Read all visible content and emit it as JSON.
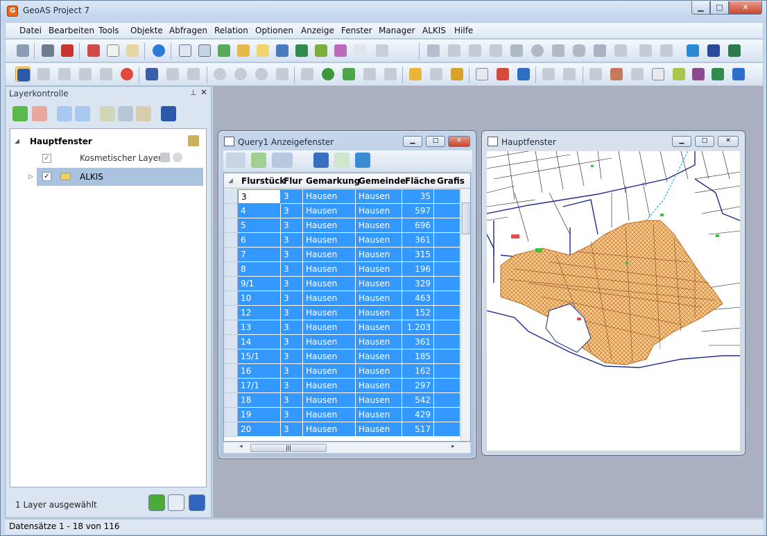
{
  "app": {
    "title": "GeoAS Project 7"
  },
  "menu": [
    "Datei",
    "Bearbeiten",
    "Tools",
    "Objekte",
    "Abfragen",
    "Relation",
    "Optionen",
    "Anzeige",
    "Fenster",
    "Manager",
    "ALKIS",
    "Hilfe"
  ],
  "layer_panel": {
    "title": "Layerkontrolle",
    "root": "Hauptfenster",
    "layers": [
      {
        "name": "Kosmetischer Layer",
        "checked": true,
        "selected": false
      },
      {
        "name": "ALKIS",
        "checked": true,
        "selected": true
      }
    ],
    "status": "1 Layer ausgewählt"
  },
  "query_window": {
    "title": "Query1 Anzeigefenster",
    "columns": [
      "Flurstück",
      "Flur",
      "Gemarkung",
      "Gemeinde",
      "Fläche",
      "Grafis"
    ],
    "rows": [
      [
        "3",
        "3",
        "Hausen",
        "Hausen",
        "35"
      ],
      [
        "4",
        "3",
        "Hausen",
        "Hausen",
        "597"
      ],
      [
        "5",
        "3",
        "Hausen",
        "Hausen",
        "696"
      ],
      [
        "6",
        "3",
        "Hausen",
        "Hausen",
        "361"
      ],
      [
        "7",
        "3",
        "Hausen",
        "Hausen",
        "315"
      ],
      [
        "8",
        "3",
        "Hausen",
        "Hausen",
        "196"
      ],
      [
        "9/1",
        "3",
        "Hausen",
        "Hausen",
        "329"
      ],
      [
        "10",
        "3",
        "Hausen",
        "Hausen",
        "463"
      ],
      [
        "12",
        "3",
        "Hausen",
        "Hausen",
        "152"
      ],
      [
        "13",
        "3",
        "Hausen",
        "Hausen",
        "1.203"
      ],
      [
        "14",
        "3",
        "Hausen",
        "Hausen",
        "361"
      ],
      [
        "15/1",
        "3",
        "Hausen",
        "Hausen",
        "185"
      ],
      [
        "16",
        "3",
        "Hausen",
        "Hausen",
        "162"
      ],
      [
        "17/1",
        "3",
        "Hausen",
        "Hausen",
        "297"
      ],
      [
        "18",
        "3",
        "Hausen",
        "Hausen",
        "542"
      ],
      [
        "19",
        "3",
        "Hausen",
        "Hausen",
        "429"
      ],
      [
        "20",
        "3",
        "Hausen",
        "Hausen",
        "517"
      ]
    ]
  },
  "map_window": {
    "title": "Hauptfenster"
  },
  "statusbar": {
    "text": "Datensätze 1 - 18 von 116"
  },
  "colors": {
    "selection": "#3399ff",
    "parcel_fill": "#f5c98a",
    "parcel_line": "#c0661a",
    "boundary": "#1a2a8a"
  }
}
